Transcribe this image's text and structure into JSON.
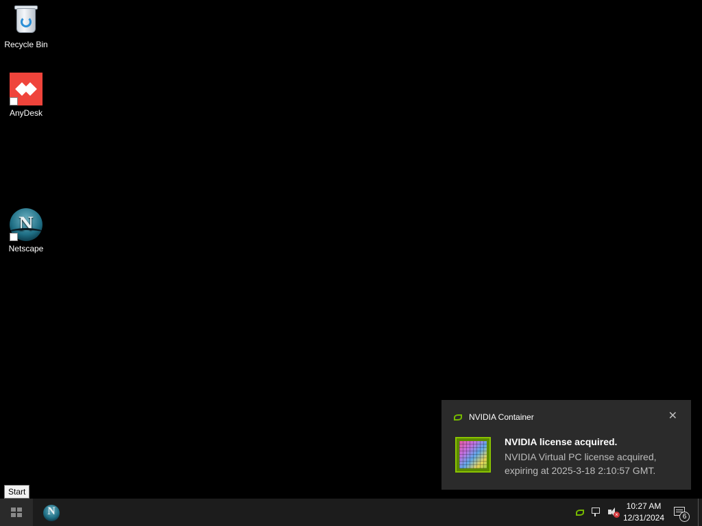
{
  "desktop": {
    "icons": [
      {
        "label": "Recycle Bin",
        "icon": "recycle-bin-icon"
      },
      {
        "label": "AnyDesk",
        "icon": "anydesk-icon"
      },
      {
        "label": "Netscape",
        "icon": "netscape-icon"
      }
    ]
  },
  "toast": {
    "app_name": "NVIDIA Container",
    "title": "NVIDIA license acquired.",
    "body": "NVIDIA Virtual PC license acquired, expiring at 2025-3-18 2:10:57 GMT.",
    "close_symbol": "✕"
  },
  "tooltip": {
    "text": "Start"
  },
  "taskbar": {
    "pinned": [
      {
        "name": "Netscape",
        "letter": "N"
      }
    ],
    "clock": {
      "time": "10:27 AM",
      "date": "12/31/2024"
    },
    "notification_count": "6"
  },
  "colors": {
    "desktop_bg": "#000000",
    "taskbar_bg": "#1c1c1c",
    "toast_bg": "#2b2b2b",
    "nvidia_green": "#76b900",
    "anydesk_red": "#ef443b"
  }
}
